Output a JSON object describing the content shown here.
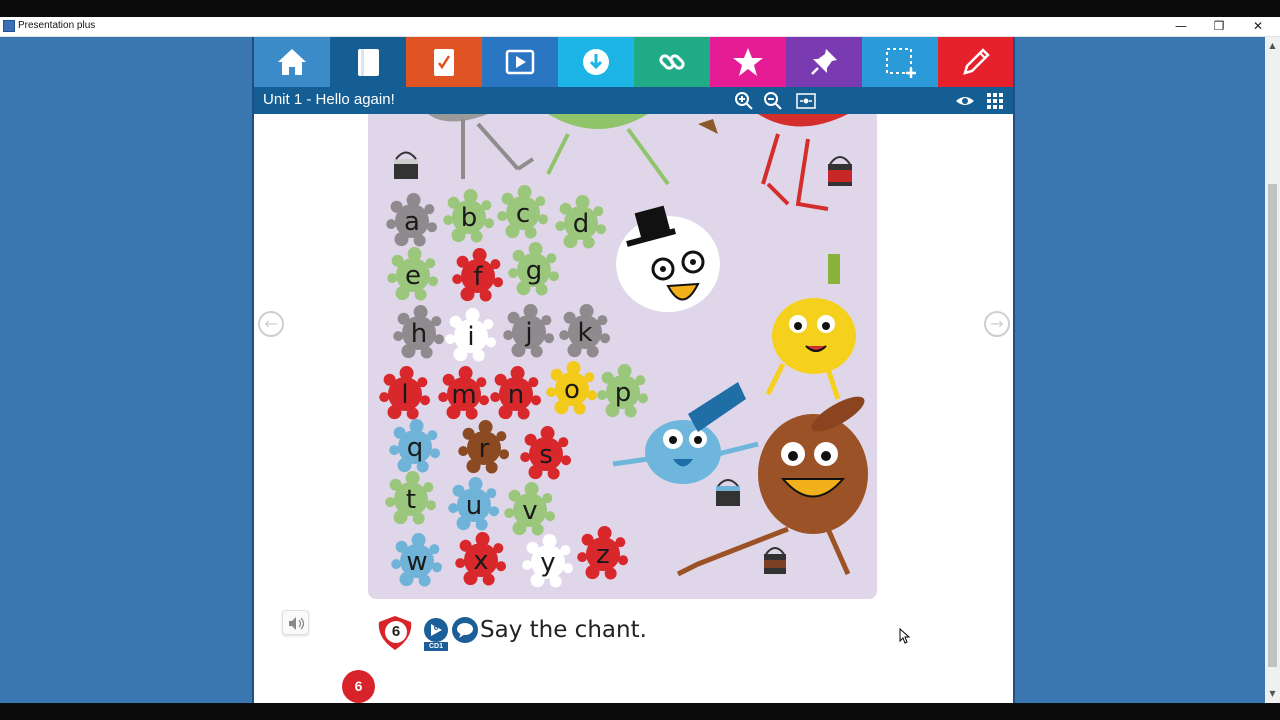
{
  "window": {
    "title": "Presentation plus",
    "minimize": "—",
    "restore": "❐",
    "close": "✕"
  },
  "toolbar": {
    "buttons": [
      {
        "name": "home",
        "color": "#3b8bc8"
      },
      {
        "name": "book",
        "color": "#155e93"
      },
      {
        "name": "homework",
        "color": "#e05424"
      },
      {
        "name": "video",
        "color": "#2b76c2"
      },
      {
        "name": "download",
        "color": "#1cb5e6"
      },
      {
        "name": "link",
        "color": "#1fab85"
      },
      {
        "name": "star",
        "color": "#e51c96"
      },
      {
        "name": "pin",
        "color": "#7a3ab2"
      },
      {
        "name": "spotlight",
        "color": "#2a9ad8"
      },
      {
        "name": "pen",
        "color": "#e7212b"
      }
    ]
  },
  "subbar": {
    "title": "Unit 1 - Hello again!"
  },
  "alphabet": [
    {
      "letter": "a",
      "color": "#8e8a8e"
    },
    {
      "letter": "b",
      "color": "#9bc77c"
    },
    {
      "letter": "c",
      "color": "#9bc77c"
    },
    {
      "letter": "d",
      "color": "#9bc77c"
    },
    {
      "letter": "e",
      "color": "#9bc77c"
    },
    {
      "letter": "f",
      "color": "#d8282b"
    },
    {
      "letter": "g",
      "color": "#9bc77c"
    },
    {
      "letter": "h",
      "color": "#8e8a8e"
    },
    {
      "letter": "i",
      "color": "#ffffff"
    },
    {
      "letter": "j",
      "color": "#8e8a8e"
    },
    {
      "letter": "k",
      "color": "#8e8a8e"
    },
    {
      "letter": "l",
      "color": "#d8282b"
    },
    {
      "letter": "m",
      "color": "#d8282b"
    },
    {
      "letter": "n",
      "color": "#d8282b"
    },
    {
      "letter": "o",
      "color": "#f3c91a"
    },
    {
      "letter": "p",
      "color": "#9bc77c"
    },
    {
      "letter": "q",
      "color": "#6fb3d8"
    },
    {
      "letter": "r",
      "color": "#8b4a22"
    },
    {
      "letter": "s",
      "color": "#d8282b"
    },
    {
      "letter": "t",
      "color": "#9bc77c"
    },
    {
      "letter": "u",
      "color": "#6fb3d8"
    },
    {
      "letter": "v",
      "color": "#9bc77c"
    },
    {
      "letter": "w",
      "color": "#6fb3d8"
    },
    {
      "letter": "x",
      "color": "#d8282b"
    },
    {
      "letter": "y",
      "color": "#ffffff"
    },
    {
      "letter": "z",
      "color": "#d8282b"
    }
  ],
  "activity": {
    "number": "6",
    "cd_label": "CD1",
    "cd_track": "6",
    "instruction": "Say the chant."
  },
  "page": {
    "number": "6"
  }
}
